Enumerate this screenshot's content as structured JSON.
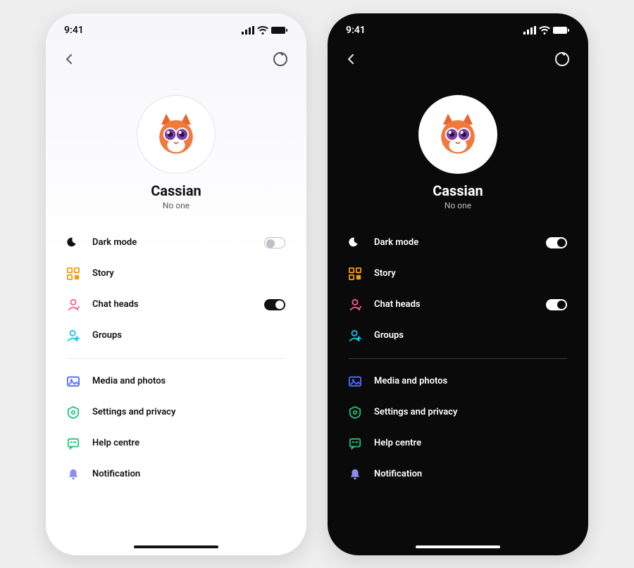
{
  "status": {
    "time": "9:41"
  },
  "profile": {
    "name": "Cassian",
    "subtitle": "No one"
  },
  "rows": {
    "dark_mode": "Dark mode",
    "story": "Story",
    "chat_heads": "Chat heads",
    "groups": "Groups",
    "media": "Media and photos",
    "settings": "Settings and privacy",
    "help": "Help centre",
    "notification": "Notification"
  },
  "toggles": {
    "light_dark_mode_on": false,
    "light_chat_heads_on": true,
    "dark_dark_mode_on": true,
    "dark_chat_heads_on": true
  },
  "colors": {
    "story_icon": "#f39c12",
    "chat_heads_icon": "#ff5d8f",
    "groups_icon": "#17c3e6",
    "media_icon": "#4f6cff",
    "settings_icon": "#1fc47a",
    "help_icon": "#1fc47a",
    "notification_icon": "#8d8df0"
  }
}
